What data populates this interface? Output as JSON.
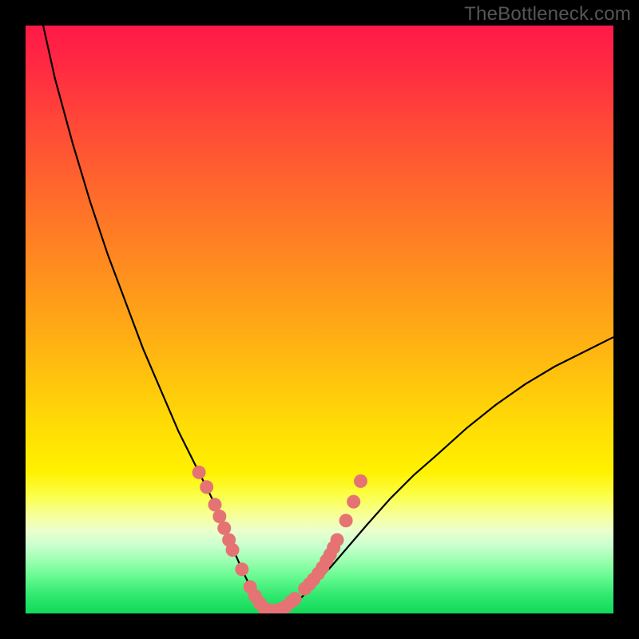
{
  "watermark": "TheBottleneck.com",
  "chart_data": {
    "type": "line",
    "title": "",
    "xlabel": "",
    "ylabel": "",
    "xlim": [
      0,
      100
    ],
    "ylim": [
      0,
      100
    ],
    "series": [
      {
        "name": "bottleneck-curve",
        "x": [
          3,
          5,
          8,
          11,
          14,
          17,
          20,
          23,
          26,
          28.5,
          30.5,
          32.5,
          34,
          35.5,
          36.8,
          38,
          39,
          39.8,
          40.6,
          41.5,
          43,
          45,
          47,
          49,
          52,
          55,
          58,
          62,
          66,
          70,
          75,
          80,
          85,
          90,
          95,
          100
        ],
        "y": [
          100,
          91,
          80,
          70,
          61,
          53,
          45,
          38,
          31,
          26,
          22,
          18,
          14,
          10.5,
          7.5,
          5,
          3.2,
          1.8,
          0.8,
          0,
          0,
          1.2,
          2.8,
          4.8,
          8,
          11.5,
          15,
          19.5,
          23.5,
          27,
          31.5,
          35.5,
          39,
          42,
          44.5,
          47
        ]
      }
    ],
    "markers": {
      "name": "data-points",
      "points": [
        {
          "x": 29.5,
          "y": 24
        },
        {
          "x": 30.8,
          "y": 21.5
        },
        {
          "x": 32.2,
          "y": 18.5
        },
        {
          "x": 33.0,
          "y": 16.5
        },
        {
          "x": 33.8,
          "y": 14.5
        },
        {
          "x": 34.6,
          "y": 12.5
        },
        {
          "x": 35.2,
          "y": 10.8
        },
        {
          "x": 36.8,
          "y": 7.5
        },
        {
          "x": 38.2,
          "y": 4.5
        },
        {
          "x": 39.0,
          "y": 3.0
        },
        {
          "x": 39.8,
          "y": 1.8
        },
        {
          "x": 40.5,
          "y": 1.0
        },
        {
          "x": 41.5,
          "y": 0.5
        },
        {
          "x": 42.5,
          "y": 0.5
        },
        {
          "x": 43.5,
          "y": 0.8
        },
        {
          "x": 44.3,
          "y": 1.2
        },
        {
          "x": 45.2,
          "y": 2.0
        },
        {
          "x": 45.8,
          "y": 2.5
        },
        {
          "x": 47.5,
          "y": 4.2
        },
        {
          "x": 48.3,
          "y": 5.0
        },
        {
          "x": 49.0,
          "y": 5.8
        },
        {
          "x": 49.8,
          "y": 6.8
        },
        {
          "x": 50.5,
          "y": 7.8
        },
        {
          "x": 51.2,
          "y": 9.0
        },
        {
          "x": 51.8,
          "y": 10.0
        },
        {
          "x": 52.4,
          "y": 11.2
        },
        {
          "x": 53.0,
          "y": 12.5
        },
        {
          "x": 54.5,
          "y": 15.8
        },
        {
          "x": 55.8,
          "y": 19.0
        },
        {
          "x": 57.0,
          "y": 22.5
        }
      ],
      "radius": 8.5
    },
    "gradient_stops": [
      {
        "offset": 0.0,
        "color": "#ff1948"
      },
      {
        "offset": 0.07,
        "color": "#ff2a42"
      },
      {
        "offset": 0.18,
        "color": "#ff4c36"
      },
      {
        "offset": 0.3,
        "color": "#ff6e2a"
      },
      {
        "offset": 0.42,
        "color": "#ff8f1e"
      },
      {
        "offset": 0.55,
        "color": "#ffb412"
      },
      {
        "offset": 0.67,
        "color": "#ffd906"
      },
      {
        "offset": 0.76,
        "color": "#fff200"
      },
      {
        "offset": 0.8,
        "color": "#fbff4a"
      },
      {
        "offset": 0.835,
        "color": "#f6ff9e"
      },
      {
        "offset": 0.86,
        "color": "#eaffce"
      },
      {
        "offset": 0.885,
        "color": "#c9ffcf"
      },
      {
        "offset": 0.91,
        "color": "#9cffb0"
      },
      {
        "offset": 0.94,
        "color": "#62f98f"
      },
      {
        "offset": 0.97,
        "color": "#2fe86f"
      },
      {
        "offset": 1.0,
        "color": "#12d95a"
      }
    ],
    "curve_color": "#000000",
    "marker_color": "#e57373"
  }
}
